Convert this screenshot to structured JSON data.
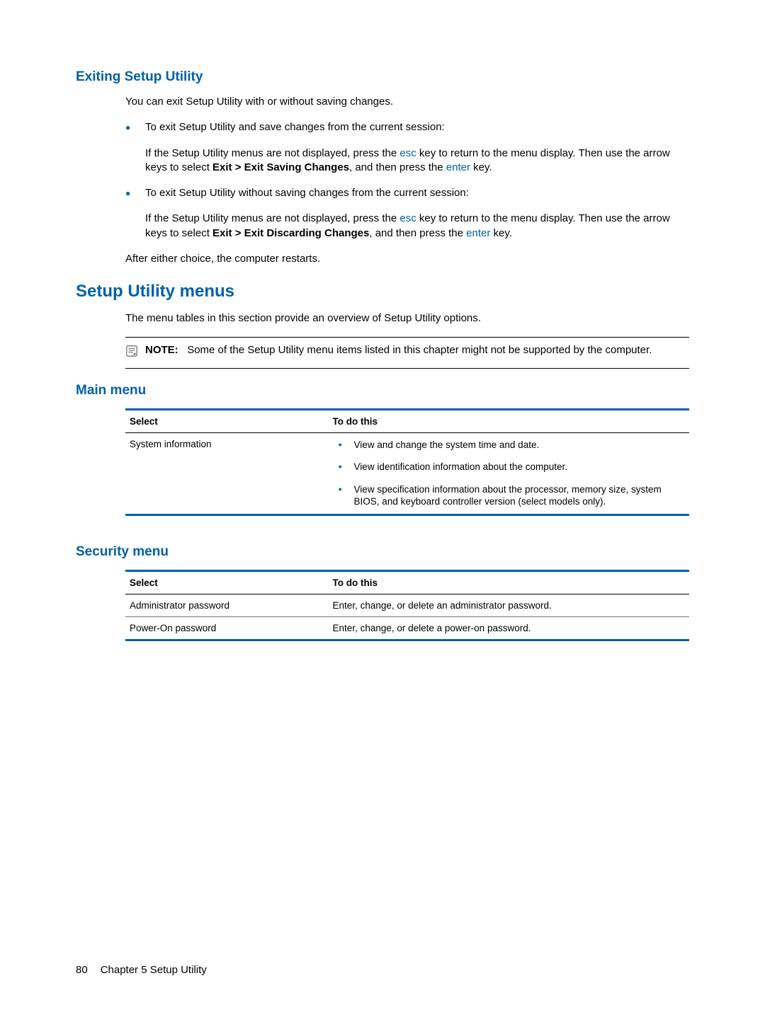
{
  "section1": {
    "heading": "Exiting Setup Utility",
    "intro": "You can exit Setup Utility with or without saving changes.",
    "b1_lead": "To exit Setup Utility and save changes from the current session:",
    "b1_p_pre": "If the Setup Utility menus are not displayed, press the ",
    "b1_p_esc": "esc",
    "b1_p_mid": " key to return to the menu display. Then use the arrow keys to select ",
    "b1_p_bold": "Exit > Exit Saving Changes",
    "b1_p_mid2": ", and then press the ",
    "b1_p_enter": "enter",
    "b1_p_end": " key.",
    "b2_lead": "To exit Setup Utility without saving changes from the current session:",
    "b2_p_pre": "If the Setup Utility menus are not displayed, press the ",
    "b2_p_esc": "esc",
    "b2_p_mid": " key to return to the menu display. Then use the arrow keys to select ",
    "b2_p_bold": "Exit > Exit Discarding Changes",
    "b2_p_mid2": ", and then press the ",
    "b2_p_enter": "enter",
    "b2_p_end": " key.",
    "outro": "After either choice, the computer restarts."
  },
  "section2": {
    "heading": "Setup Utility menus",
    "intro": "The menu tables in this section provide an overview of Setup Utility options.",
    "note_label": "NOTE:",
    "note_text": "Some of the Setup Utility menu items listed in this chapter might not be supported by the computer."
  },
  "main_menu": {
    "heading": "Main menu",
    "col_select": "Select",
    "col_todo": "To do this",
    "row1_select": "System information",
    "row1_b1": "View and change the system time and date.",
    "row1_b2": "View identification information about the computer.",
    "row1_b3": "View specification information about the processor, memory size, system BIOS, and keyboard controller version (select models only)."
  },
  "security_menu": {
    "heading": "Security menu",
    "col_select": "Select",
    "col_todo": "To do this",
    "r1_select": "Administrator password",
    "r1_todo": "Enter, change, or delete an administrator password.",
    "r2_select": "Power-On password",
    "r2_todo": "Enter, change, or delete a power-on password."
  },
  "footer": {
    "page": "80",
    "chapter": "Chapter 5   Setup Utility"
  }
}
